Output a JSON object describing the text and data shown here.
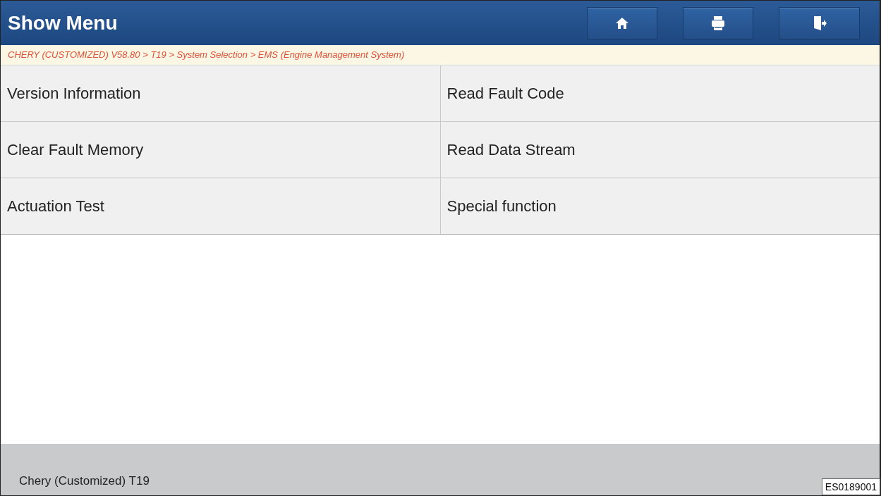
{
  "header": {
    "title": "Show Menu",
    "buttons": [
      {
        "kind": "home"
      },
      {
        "kind": "print"
      },
      {
        "kind": "exit"
      }
    ]
  },
  "breadcrumb": "CHERY (CUSTOMIZED) V58.80 > T19 > System Selection > EMS (Engine Management System)",
  "menu_items": [
    "Version Information",
    "Read Fault Code",
    "Clear Fault Memory",
    "Read Data Stream",
    "Actuation Test",
    "Special function"
  ],
  "footer": {
    "vehicle": "Chery (Customized) T19"
  },
  "figure_code": "ES0189001"
}
